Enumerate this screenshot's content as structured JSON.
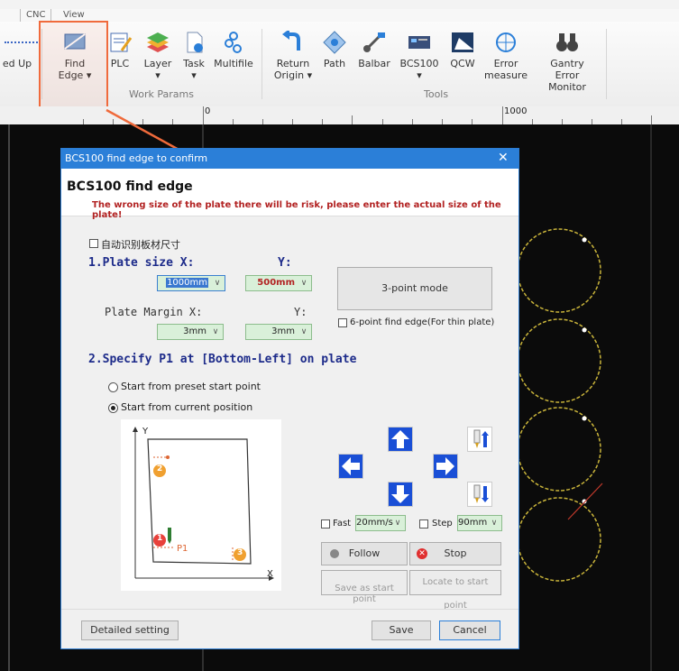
{
  "menu": {
    "items": [
      "CNC",
      "View"
    ]
  },
  "ribbon": {
    "partial_left_label": "ed Up",
    "work_params_buttons": [
      {
        "label": "Find\nEdge ▾",
        "icon": "find-edge-icon"
      },
      {
        "label": "PLC",
        "icon": "plc-icon"
      },
      {
        "label": "Layer\n▾",
        "icon": "layer-icon"
      },
      {
        "label": "Task\n▾",
        "icon": "task-icon"
      },
      {
        "label": "Multifile",
        "icon": "multifile-icon"
      }
    ],
    "work_params_group": "Work Params",
    "tools_buttons": [
      {
        "label": "Return\nOrigin ▾",
        "icon": "return-origin-icon"
      },
      {
        "label": "Path",
        "icon": "path-icon"
      },
      {
        "label": "Balbar",
        "icon": "balbar-icon"
      },
      {
        "label": "BCS100\n▾",
        "icon": "bcs100-icon"
      },
      {
        "label": "QCW",
        "icon": "qcw-icon"
      },
      {
        "label": "Error\nmeasure",
        "icon": "error-measure-icon"
      },
      {
        "label": "Gantry Error\nMonitor",
        "icon": "gantry-monitor-icon"
      }
    ],
    "tools_group": "Tools"
  },
  "ruler": {
    "label_0": "0",
    "label_1000": "1000"
  },
  "dialog": {
    "title": "BCS100 find edge to confirm",
    "header": "BCS100 find edge",
    "warning": "The wrong size of the plate there will be risk, please enter the actual size of the plate!",
    "auto_detect_label": "自动识别板材尺寸",
    "plate_size_label": "1.Plate size  X:",
    "y_label": "Y:",
    "plate_x": "1000mm",
    "plate_y": "500mm",
    "three_point_label": "3-point mode",
    "plate_margin_label": "Plate Margin  X:",
    "margin_y_label": "Y:",
    "margin_x": "3mm",
    "margin_y": "3mm",
    "six_point_label": "6-point find edge(For thin plate)",
    "specify_label": "2.Specify P1 at [Bottom-Left] on plate",
    "radio_preset": "Start from preset start point",
    "radio_current": "Start from current position",
    "fast_label": "Fast",
    "fast_value": "20mm/s",
    "step_label": "Step",
    "step_value": "90mm",
    "follow_label": "Follow",
    "stop_label": "Stop",
    "save_start_label": "Save as start\npoint",
    "locate_start_label": "Locate to start point",
    "detailed_label": "Detailed setting",
    "save_label": "Save",
    "cancel_label": "Cancel",
    "diagram": {
      "y_axis": "Y",
      "x_axis": "X",
      "p1": "P1",
      "n1": "1",
      "n2": "2",
      "n3": "3"
    }
  },
  "colors": {
    "accent": "#2b7fd8",
    "warning": "#b22222",
    "highlight": "#f06a3c",
    "combo_green": "#d9f0d9"
  }
}
